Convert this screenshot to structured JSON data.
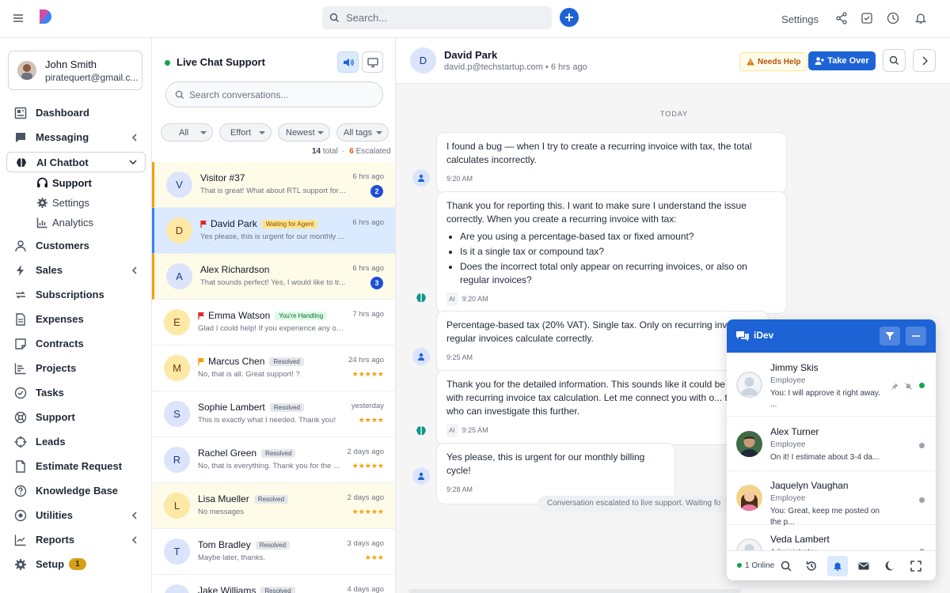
{
  "topbar": {
    "search_placeholder": "Search...",
    "settings_label": "Settings"
  },
  "user": {
    "name": "John Smith",
    "email": "piratequert@gmail.c..."
  },
  "nav": {
    "dashboard": "Dashboard",
    "messaging": "Messaging",
    "ai_chatbot": "AI Chatbot",
    "support": "Support",
    "settings": "Settings",
    "analytics": "Analytics",
    "customers": "Customers",
    "sales": "Sales",
    "subscriptions": "Subscriptions",
    "expenses": "Expenses",
    "contracts": "Contracts",
    "projects": "Projects",
    "tasks": "Tasks",
    "support2": "Support",
    "leads": "Leads",
    "estimate_request": "Estimate Request",
    "knowledge_base": "Knowledge Base",
    "utilities": "Utilities",
    "reports": "Reports",
    "setup": "Setup",
    "setup_badge": "1"
  },
  "conv_panel": {
    "title": "Live Chat Support",
    "search_placeholder": "Search conversations...",
    "filters": [
      "All",
      "Effort",
      "Newest",
      "All tags"
    ],
    "total_count": "14",
    "total_label": "total",
    "escalated_count": "6",
    "escalated_label": "Escalated",
    "conversations": [
      {
        "initial": "V",
        "name": "Visitor #37",
        "tag": "",
        "msg": "That is great! What about RTL support for ...",
        "time": "6 hrs ago",
        "badge": "2",
        "stars": ""
      },
      {
        "initial": "D",
        "name": "David Park",
        "tag": "Waiting for Agent",
        "msg": "Yes please, this is urgent for our monthly ...",
        "time": "6 hrs ago",
        "badge": "",
        "stars": ""
      },
      {
        "initial": "A",
        "name": "Alex Richardson",
        "tag": "",
        "msg": "That sounds perfect! Yes, I would like to tr...",
        "time": "6 hrs ago",
        "badge": "3",
        "stars": ""
      },
      {
        "initial": "E",
        "name": "Emma Watson",
        "tag": "You're Handling",
        "msg": "Glad I could help! If you experience any ot...",
        "time": "7 hrs ago",
        "badge": "",
        "stars": ""
      },
      {
        "initial": "M",
        "name": "Marcus Chen",
        "tag": "Resolved",
        "msg": "No, that is all. Great support! ?",
        "time": "24 hrs ago",
        "badge": "",
        "stars": "★★★★★"
      },
      {
        "initial": "S",
        "name": "Sophie Lambert",
        "tag": "Resolved",
        "msg": "This is exactly what I needed. Thank you!",
        "time": "yesterday",
        "badge": "",
        "stars": "★★★★"
      },
      {
        "initial": "R",
        "name": "Rachel Green",
        "tag": "Resolved",
        "msg": "No, that is everything. Thank you for the ...",
        "time": "2 days ago",
        "badge": "",
        "stars": "★★★★★"
      },
      {
        "initial": "L",
        "name": "Lisa Mueller",
        "tag": "Resolved",
        "msg": "No messages",
        "time": "2 days ago",
        "badge": "",
        "stars": "★★★★★"
      },
      {
        "initial": "T",
        "name": "Tom Bradley",
        "tag": "Resolved",
        "msg": "Maybe later, thanks.",
        "time": "3 days ago",
        "badge": "",
        "stars": "★★★"
      },
      {
        "initial": "J",
        "name": "Jake Williams",
        "tag": "Resolved",
        "msg": "",
        "time": "4 days ago",
        "badge": "",
        "stars": ""
      }
    ]
  },
  "chat": {
    "contact_initial": "D",
    "contact_name": "David Park",
    "contact_sub": "david.p@techstartup.com • 6 hrs ago",
    "needs_help": "Needs Help",
    "take_over": "Take Over",
    "day_label": "TODAY",
    "messages": [
      {
        "text": "I found a bug — when I try to create a recurring invoice with tax, the total calculates incorrectly.",
        "time": "9:20 AM"
      },
      {
        "text": "Thank you for reporting this. I want to make sure I understand the issue correctly. When you create a recurring invoice with tax:",
        "bullets": [
          "Are you using a percentage-based tax or fixed amount?",
          "Is it a single tax or compound tax?",
          "Does the incorrect total only appear on recurring invoices, or also on regular invoices?"
        ],
        "ai": "AI",
        "time": "9:20 AM"
      },
      {
        "text": "Percentage-based tax (20% VAT). Single tax. Only on recurring invoic... regular invoices calculate correctly.",
        "time": "9:25 AM"
      },
      {
        "text": "Thank you for the detailed information. This sounds like it could be a bug with recurring invoice tax calculation. Let me connect you with o... team who can investigate this further.",
        "ai": "AI",
        "time": "9:25 AM"
      },
      {
        "text": "Yes please, this is urgent for our monthly billing cycle!",
        "time": "9:28 AM"
      }
    ],
    "escalation": "Conversation escalated to live support. Waiting fo"
  },
  "widget": {
    "title": "iDev",
    "online": "1 Online",
    "contacts": [
      {
        "name": "Jimmy Skis",
        "role": "Employee",
        "msg": "You: I will approve it right away. ..."
      },
      {
        "name": "Alex Turner",
        "role": "Employee",
        "msg": "On it! I estimate about 3-4 da..."
      },
      {
        "name": "Jaquelyn Vaughan",
        "role": "Employee",
        "msg": "You: Great, keep me posted on the p..."
      },
      {
        "name": "Veda Lambert",
        "role": "Administrator",
        "msg": ""
      }
    ]
  },
  "colors": {
    "primary": "#1d63d6",
    "online": "#16a34a",
    "escalated": "#ea580c",
    "star": "#f59e0b"
  }
}
